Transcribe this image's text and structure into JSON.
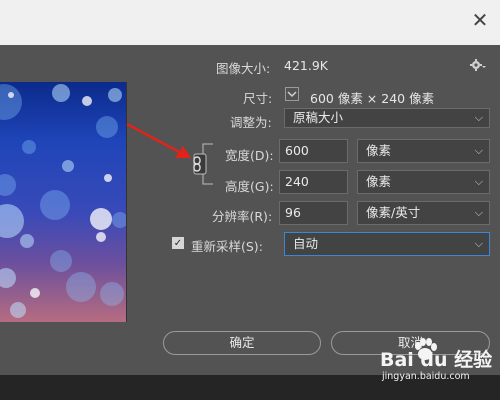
{
  "dialog": {
    "image_size_label": "图像大小:",
    "image_size_value": "421.9K",
    "dimensions_label": "尺寸:",
    "dimensions_value": "600 像素 × 240 像素",
    "fit_to_label": "调整为:",
    "fit_to_value": "原稿大小",
    "width_label": "宽度(D):",
    "width_value": "600",
    "width_unit": "像素",
    "height_label": "高度(G):",
    "height_value": "240",
    "height_unit": "像素",
    "resolution_label": "分辨率(R):",
    "resolution_value": "96",
    "resolution_unit": "像素/英寸",
    "resample_label": "重新采样(S):",
    "resample_checked": true,
    "resample_value": "自动",
    "ok_label": "确定",
    "cancel_label": "取消"
  },
  "watermark": {
    "brand": "Bai du 经验",
    "url": "jingyan.baidu.com"
  },
  "colors": {
    "dialog_bg": "#535353",
    "arrow": "#e0231b",
    "focus": "#3b86d6"
  },
  "icons": {
    "gear": "gear-icon",
    "chain": "chain-link-icon",
    "chevron": "chevron-down-icon"
  }
}
